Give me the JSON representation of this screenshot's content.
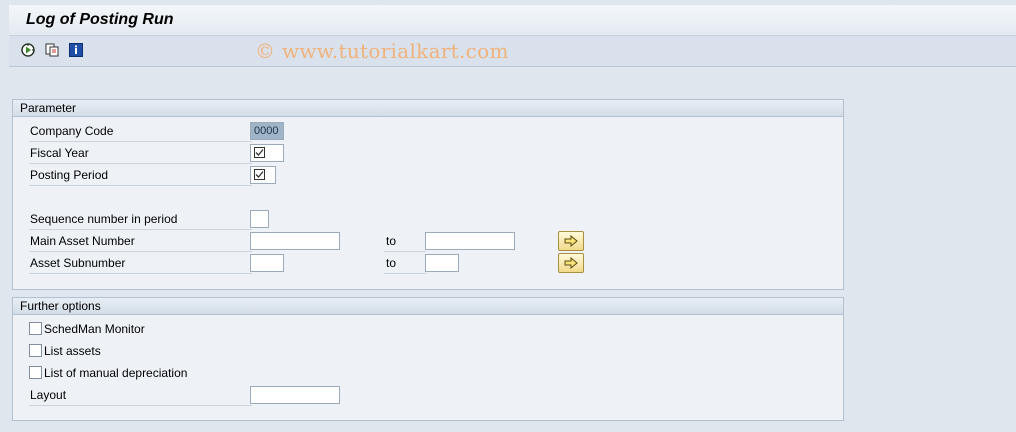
{
  "title": "Log of Posting Run",
  "watermark": "© www.tutorialkart.com",
  "toolbar": {
    "icons": [
      "execute-icon",
      "variant-icon",
      "info-icon"
    ]
  },
  "parameter": {
    "header": "Parameter",
    "company_code": {
      "label": "Company Code",
      "value": "0000"
    },
    "fiscal_year": {
      "label": "Fiscal Year",
      "value": ""
    },
    "posting_period": {
      "label": "Posting Period",
      "value": ""
    },
    "sequence_number": {
      "label": "Sequence number in period",
      "value": ""
    },
    "main_asset": {
      "label": "Main Asset Number",
      "from": "",
      "to_label": "to",
      "to": ""
    },
    "asset_sub": {
      "label": "Asset Subnumber",
      "from": "",
      "to_label": "to",
      "to": ""
    }
  },
  "further": {
    "header": "Further options",
    "schedman": {
      "label": "SchedMan Monitor",
      "checked": false
    },
    "list_assets": {
      "label": "List assets",
      "checked": false
    },
    "manual_dep": {
      "label": "List of manual depreciation",
      "checked": false
    },
    "layout": {
      "label": "Layout",
      "value": ""
    }
  },
  "colors": {
    "background": "#dfe6ee",
    "readonly": "#9fb4c7",
    "button": "#f1d98a"
  }
}
